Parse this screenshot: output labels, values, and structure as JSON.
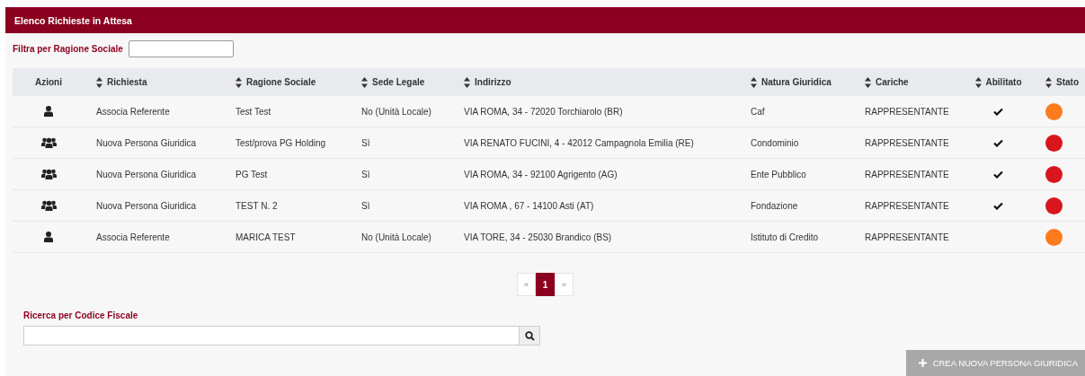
{
  "panel": {
    "title": "Elenco Richieste in Attesa"
  },
  "filter": {
    "label": "Filtra per Ragione Sociale"
  },
  "table": {
    "columns": [
      {
        "label": "Azioni",
        "sortable": false
      },
      {
        "label": "Richiesta",
        "sortable": true
      },
      {
        "label": "Ragione Sociale",
        "sortable": true
      },
      {
        "label": "Sede Legale",
        "sortable": true
      },
      {
        "label": "Indirizzo",
        "sortable": true
      },
      {
        "label": "Natura Giuridica",
        "sortable": true
      },
      {
        "label": "Cariche",
        "sortable": true
      },
      {
        "label": "Abilitato",
        "sortable": true
      },
      {
        "label": "Stato",
        "sortable": true
      }
    ],
    "rows": [
      {
        "kind": "person",
        "richiesta": "Associa Referente",
        "ragione_sociale": "Test Test",
        "sede_legale": "No (Unità Locale)",
        "indirizzo": "VIA ROMA, 34 - 72020 Torchiarolo (BR)",
        "natura_giuridica": "Caf",
        "cariche": "RAPPRESENTANTE",
        "abilitato": true,
        "color": "#fc7b1c"
      },
      {
        "kind": "group",
        "richiesta": "Nuova Persona Giuridica",
        "ragione_sociale": "Test/prova PG Holding",
        "sede_legale": "Sì",
        "indirizzo": "VIA RENATO FUCINI, 4 - 42012 Campagnola Emilia (RE)",
        "natura_giuridica": "Condominio",
        "cariche": "RAPPRESENTANTE",
        "abilitato": true,
        "color": "#d7161d"
      },
      {
        "kind": "group",
        "richiesta": "Nuova Persona Giuridica",
        "ragione_sociale": "PG Test",
        "sede_legale": "Sì",
        "indirizzo": "VIA ROMA, 34 - 92100 Agrigento (AG)",
        "natura_giuridica": "Ente Pubblico",
        "cariche": "RAPPRESENTANTE",
        "abilitato": true,
        "color": "#d7161d"
      },
      {
        "kind": "group",
        "richiesta": "Nuova Persona Giuridica",
        "ragione_sociale": "TEST N. 2",
        "sede_legale": "Sì",
        "indirizzo": "VIA ROMA , 67 - 14100 Asti (AT)",
        "natura_giuridica": "Fondazione",
        "cariche": "RAPPRESENTANTE",
        "abilitato": true,
        "color": "#d7161d"
      },
      {
        "kind": "person",
        "richiesta": "Associa Referente",
        "ragione_sociale": "MARICA TEST",
        "sede_legale": "No (Unità Locale)",
        "indirizzo": "VIA TORE, 34 - 25030 Brandico (BS)",
        "natura_giuridica": "Istituto di Credito",
        "cariche": "RAPPRESENTANTE",
        "abilitato": false,
        "color": "#fc7b1c"
      }
    ]
  },
  "pagination": [
    {
      "label": "«",
      "selected": false
    },
    {
      "label": "1",
      "selected": true
    },
    {
      "label": "»",
      "selected": false
    }
  ],
  "search": {
    "label": "Ricerca per Codice Fiscale"
  },
  "create_button": {
    "label": "CREA NUOVA PERSONA GIURIDICA",
    "disabled": true
  }
}
